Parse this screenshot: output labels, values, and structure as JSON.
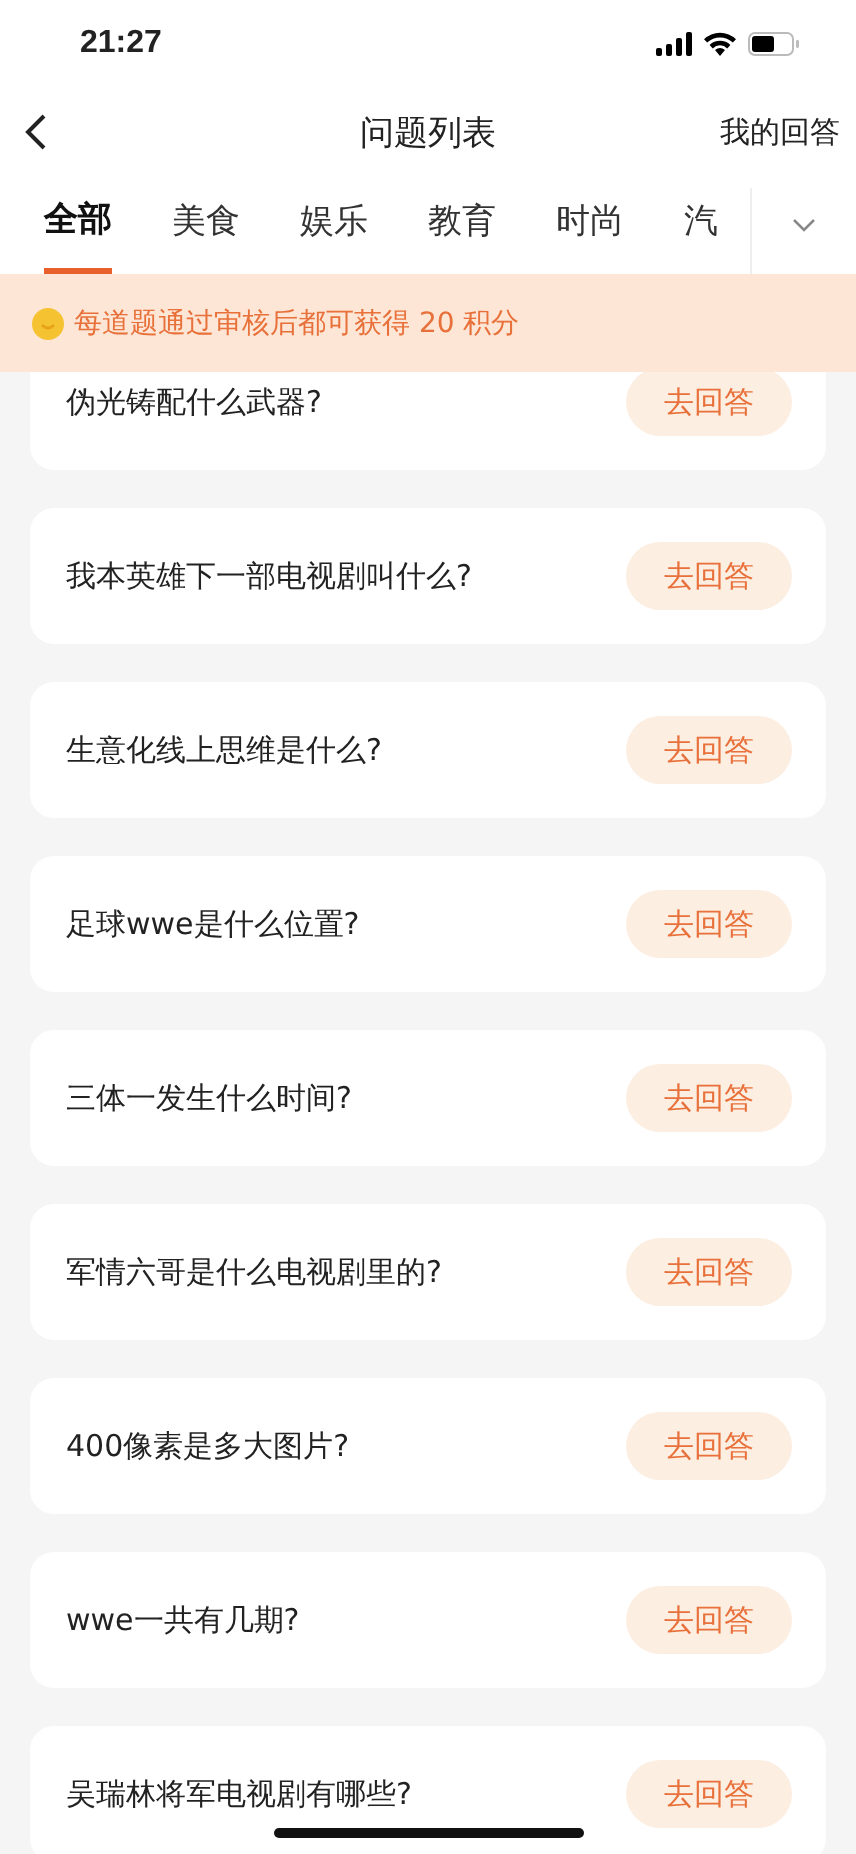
{
  "status_bar": {
    "time": "21:27"
  },
  "nav": {
    "title": "问题列表",
    "action": "我的回答"
  },
  "tabs": [
    {
      "label": "全部",
      "selected": true
    },
    {
      "label": "美食",
      "selected": false
    },
    {
      "label": "娱乐",
      "selected": false
    },
    {
      "label": "教育",
      "selected": false
    },
    {
      "label": "时尚",
      "selected": false
    },
    {
      "label": "汽",
      "selected": false
    }
  ],
  "banner": {
    "text": "每道题通过审核后都可获得 20 积分"
  },
  "questions": [
    {
      "title": "伪光铸配什么武器?",
      "button": "去回答"
    },
    {
      "title": "我本英雄下一部电视剧叫什么?",
      "button": "去回答"
    },
    {
      "title": "生意化线上思维是什么?",
      "button": "去回答"
    },
    {
      "title": "足球wwe是什么位置?",
      "button": "去回答"
    },
    {
      "title": "三体一发生什么时间?",
      "button": "去回答"
    },
    {
      "title": "军情六哥是什么电视剧里的?",
      "button": "去回答"
    },
    {
      "title": "400像素是多大图片?",
      "button": "去回答"
    },
    {
      "title": "wwe一共有几期?",
      "button": "去回答"
    },
    {
      "title": "吴瑞林将军电视剧有哪些?",
      "button": "去回答"
    }
  ]
}
